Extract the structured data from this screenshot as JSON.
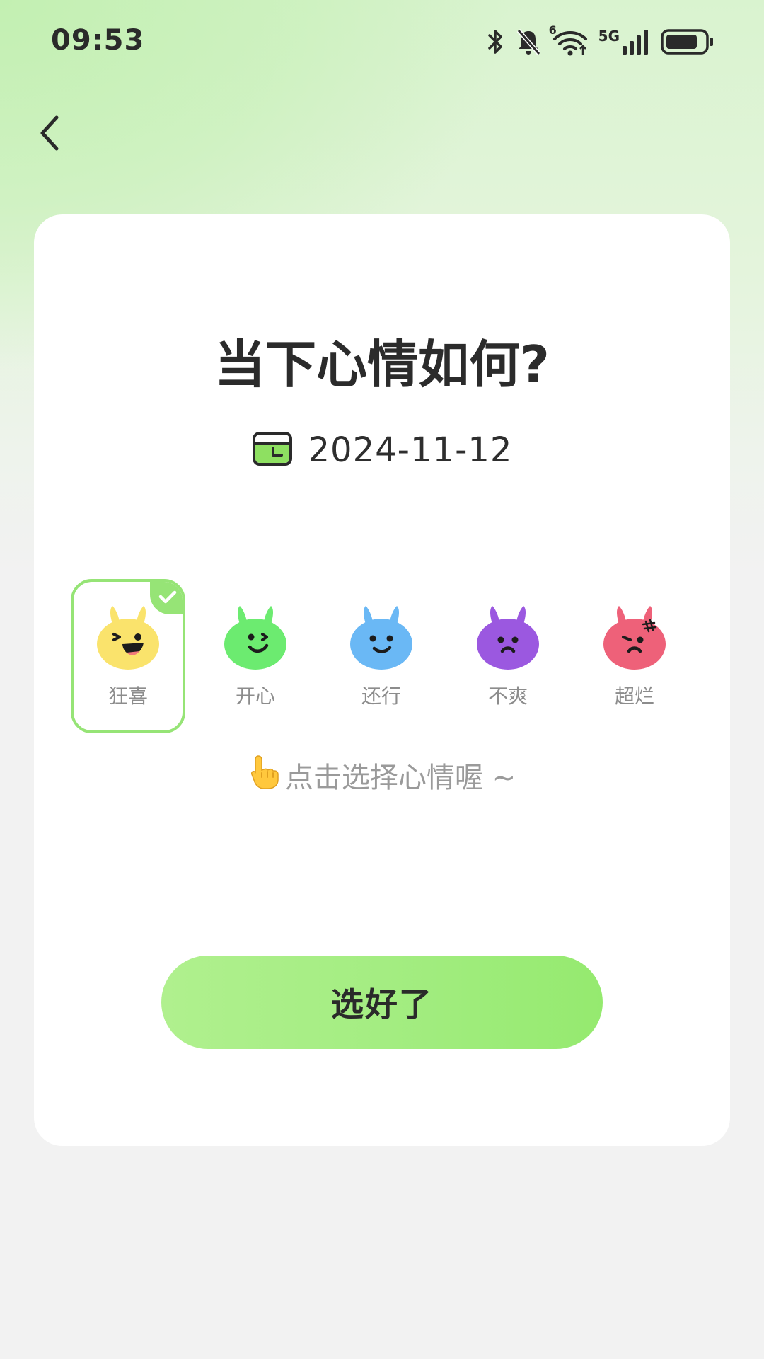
{
  "status_bar": {
    "time": "09:53",
    "network_label": "5G",
    "wifi_badge": "6",
    "icons": [
      "bluetooth-icon",
      "bell-muted-icon",
      "wifi-icon",
      "signal-icon",
      "battery-icon"
    ],
    "battery_level": 0.7
  },
  "nav": {
    "back_icon": "chevron-left-icon"
  },
  "card": {
    "title": "当下心情如何?",
    "date": "2024-11-12",
    "date_icon": "calendar-icon",
    "moods": [
      {
        "label": "狂喜",
        "color": "#FAE36C",
        "selected": true
      },
      {
        "label": "开心",
        "color": "#6CEB70",
        "selected": false
      },
      {
        "label": "还行",
        "color": "#6AB8F5",
        "selected": false
      },
      {
        "label": "不爽",
        "color": "#9B58E0",
        "selected": false
      },
      {
        "label": "超烂",
        "color": "#EE6179",
        "selected": false
      }
    ],
    "hint": "点击选择心情喔 ~",
    "hint_icon": "pointing-hand-icon",
    "confirm_label": "选好了"
  },
  "colors": {
    "accent": "#96E476",
    "button_gradient": [
      "#B0F08E",
      "#95EA6F"
    ],
    "text_dark": "#2B2B2B",
    "text_muted": "#8C8C8C"
  }
}
